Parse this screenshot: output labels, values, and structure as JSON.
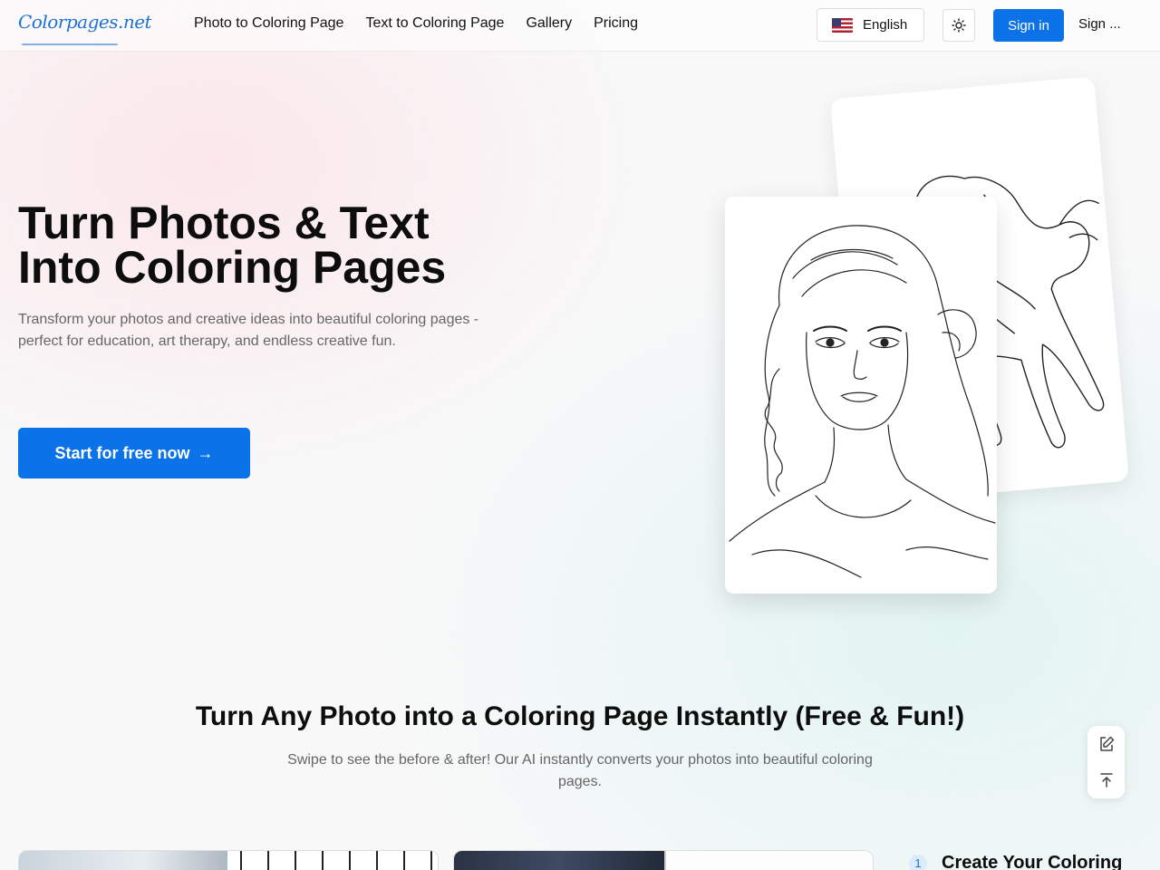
{
  "header": {
    "logo_text": "Colorpages.net",
    "nav": [
      {
        "label": "Photo to Coloring Page"
      },
      {
        "label": "Text to Coloring Page"
      },
      {
        "label": "Gallery"
      },
      {
        "label": "Pricing"
      }
    ],
    "language": {
      "label": "English",
      "icon": "us-flag-icon"
    },
    "theme_icon": "sun-icon",
    "sign_in": "Sign in",
    "sign_up": "Sign ..."
  },
  "hero": {
    "title_line1": "Turn Photos & Text",
    "title_line2": "Into Coloring Pages",
    "subtitle": "Transform your photos and creative ideas into beautiful coloring pages - perfect for education, art therapy, and endless creative fun.",
    "cta_label": "Start for free now",
    "cta_arrow": "→"
  },
  "section": {
    "title": "Turn Any Photo into a Coloring Page Instantly (Free & Fun!)",
    "subtitle": "Swipe to see the before & after! Our AI instantly converts your photos into beautiful coloring pages."
  },
  "steps": [
    {
      "number": "1",
      "title": "Create Your Coloring"
    }
  ],
  "colors": {
    "accent": "#0b72e7",
    "text": "#0d0d0d",
    "muted": "#666666"
  }
}
